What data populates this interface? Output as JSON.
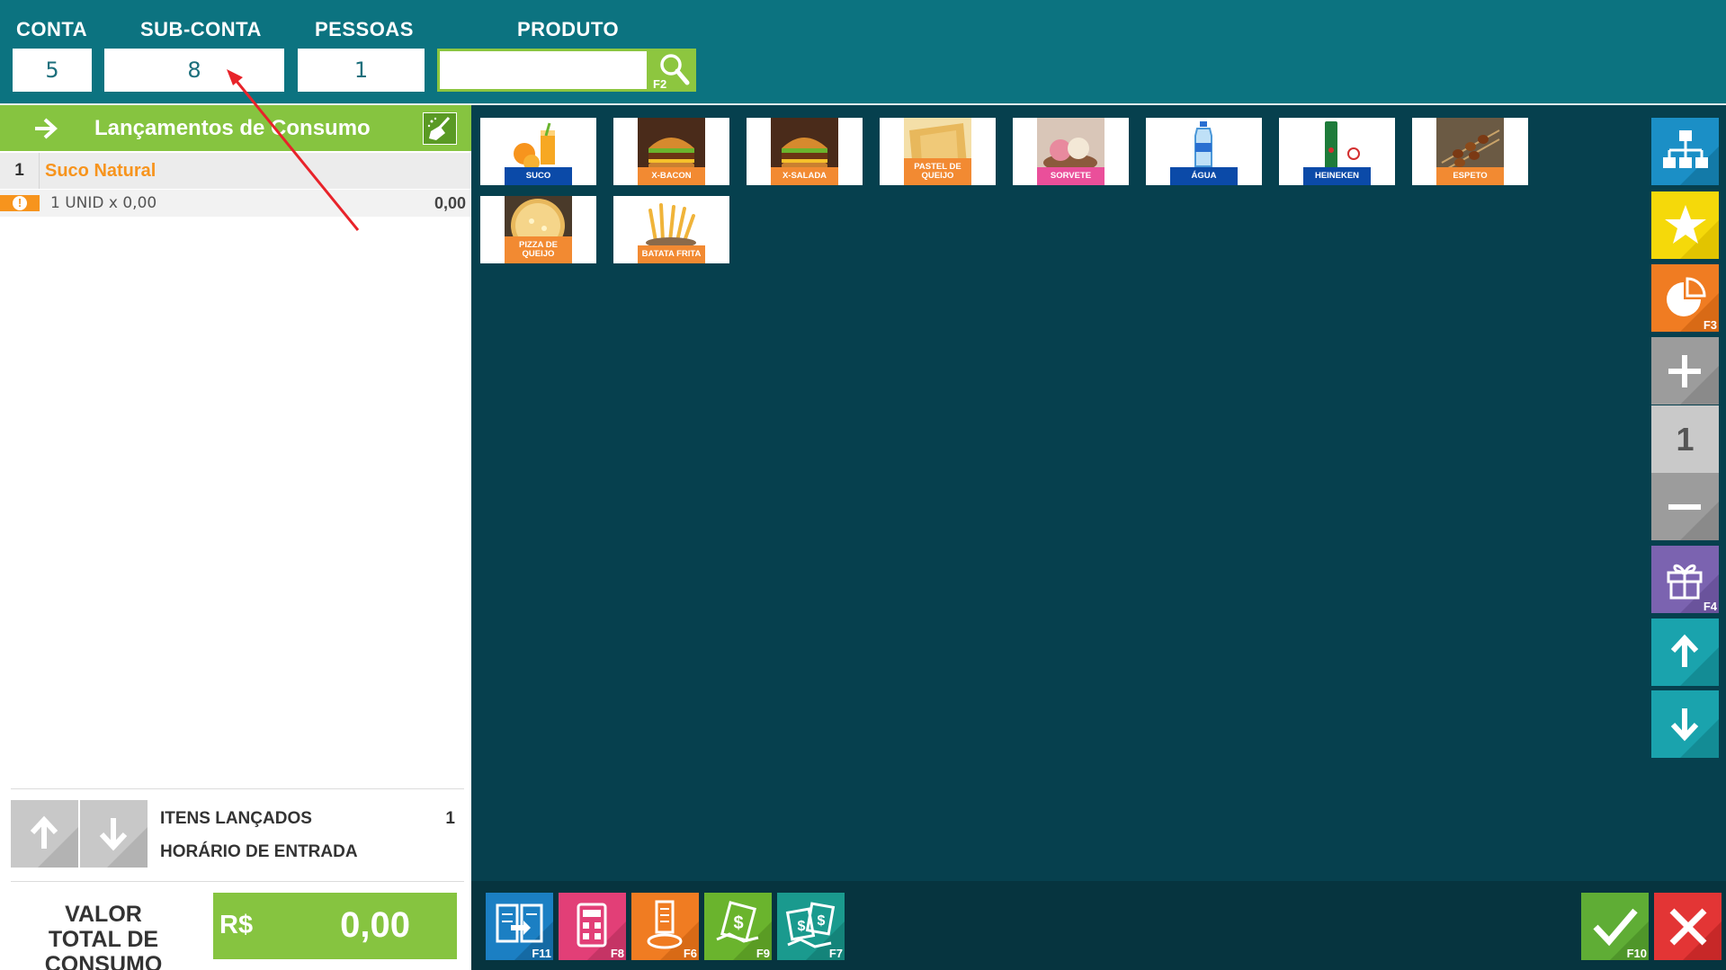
{
  "header": {
    "conta": {
      "label": "CONTA",
      "value": "5"
    },
    "subconta": {
      "label": "SUB-CONTA",
      "value": "8"
    },
    "pessoas": {
      "label": "PESSOAS",
      "value": "1"
    },
    "produto": {
      "label": "PRODUTO",
      "value": ""
    },
    "search_fkey": "F2"
  },
  "left_panel": {
    "title": "Lançamentos de Consumo",
    "items": [
      {
        "number": "1",
        "name": "Suco Natural",
        "detail": "1 UNID x 0,00",
        "value": "0,00"
      }
    ],
    "stats": {
      "itens_label": "ITENS LANÇADOS",
      "itens_value": "1",
      "horario_label": "HORÁRIO DE ENTRADA",
      "horario_value": ""
    },
    "total": {
      "label": "VALOR TOTAL DE CONSUMO",
      "currency": "R$",
      "amount": "0,00"
    }
  },
  "products": [
    {
      "label": "SUCO",
      "color": "#0b4aa8",
      "icon": "juice"
    },
    {
      "label": "X-BACON",
      "color": "#f28a32",
      "icon": "burger"
    },
    {
      "label": "X-SALADA",
      "color": "#f28a32",
      "icon": "burger"
    },
    {
      "label": "PASTEL DE QUEIJO",
      "color": "#f28a32",
      "icon": "pastel"
    },
    {
      "label": "SORVETE",
      "color": "#ea4f9a",
      "icon": "icecream"
    },
    {
      "label": "ÁGUA",
      "color": "#0b4aa8",
      "icon": "water"
    },
    {
      "label": "HEINEKEN",
      "color": "#0b4aa8",
      "icon": "beer"
    },
    {
      "label": "ESPETO",
      "color": "#f28a32",
      "icon": "skewer"
    },
    {
      "label": "PIZZA DE QUEIJO",
      "color": "#f28a32",
      "icon": "pizza"
    },
    {
      "label": "BATATA FRITA",
      "color": "#f28a32",
      "icon": "fries"
    }
  ],
  "right_toolbar": {
    "quantity": "1",
    "buttons": [
      {
        "name": "categories",
        "color": "#1b8fc6",
        "fkey": ""
      },
      {
        "name": "favorites",
        "color": "#f5d90a",
        "fkey": ""
      },
      {
        "name": "partial",
        "color": "#f07c22",
        "fkey": "F3"
      },
      {
        "name": "plus",
        "color": "#9c9c9c",
        "fkey": ""
      },
      {
        "name": "minus",
        "color": "#9c9c9c",
        "fkey": ""
      },
      {
        "name": "gift",
        "color": "#7b63b0",
        "fkey": "F4"
      },
      {
        "name": "up",
        "color": "#1aa3ad",
        "fkey": ""
      },
      {
        "name": "down",
        "color": "#1aa3ad",
        "fkey": ""
      }
    ]
  },
  "bottom_toolbar": [
    {
      "name": "transfer",
      "color": "#1b7fc3",
      "fkey": "F11"
    },
    {
      "name": "calculator",
      "color": "#e23f77",
      "fkey": "F8"
    },
    {
      "name": "receipt",
      "color": "#f07c22",
      "fkey": "F6"
    },
    {
      "name": "payment",
      "color": "#6ab42d",
      "fkey": "F9"
    },
    {
      "name": "split-payment",
      "color": "#1a9a8e",
      "fkey": "F7"
    }
  ],
  "actions": {
    "confirm": {
      "color": "#5fad35",
      "fkey": "F10"
    },
    "cancel": {
      "color": "#e33535",
      "fkey": ""
    }
  }
}
